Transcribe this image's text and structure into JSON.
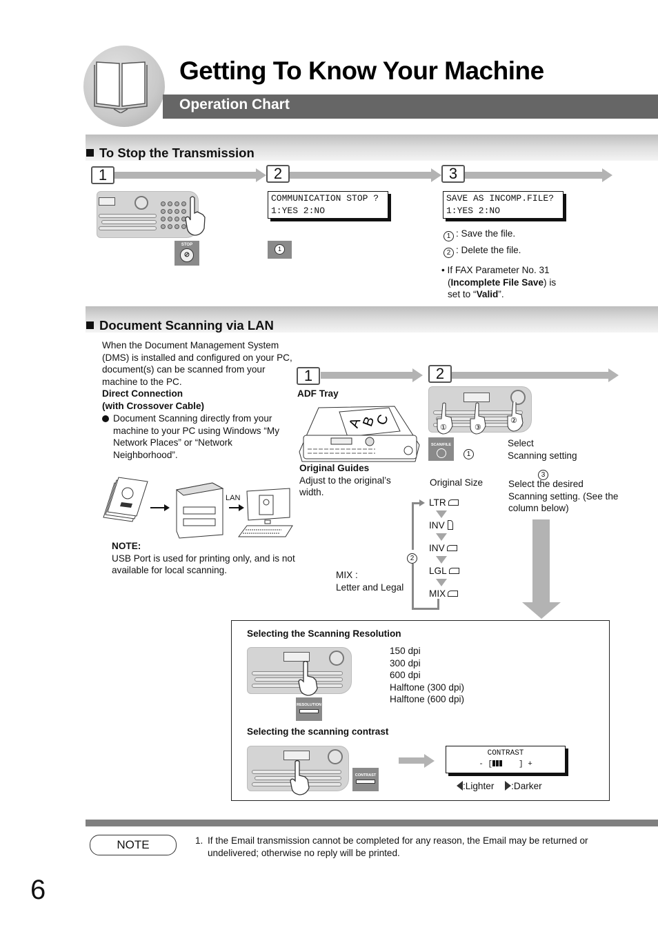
{
  "header": {
    "title": "Getting To Know Your Machine",
    "subtitle": "Operation Chart",
    "icon": "book-icon"
  },
  "stop_section": {
    "title": "To Stop the Transmission",
    "steps": [
      {
        "number": "1",
        "button_label": "STOP"
      },
      {
        "number": "2",
        "lcd_line1": "COMMUNICATION STOP ?",
        "lcd_line2": "1:YES 2:NO",
        "button_label": "1"
      },
      {
        "number": "3",
        "lcd_line1": "SAVE AS INCOMP.FILE?",
        "lcd_line2": "1:YES 2:NO",
        "options": [
          {
            "key": "1",
            "text": ": Save the file."
          },
          {
            "key": "2",
            "text": ": Delete the file."
          }
        ],
        "note_prefix": "• If FAX Parameter No. 31",
        "note_open": "(",
        "note_bold1": "Incomplete File Save",
        "note_mid": ") is",
        "note_set": "set to “",
        "note_bold2": "Valid",
        "note_end": "”."
      }
    ]
  },
  "scan_section": {
    "title": "Document Scanning via LAN",
    "intro": "When the Document Management System (DMS) is installed and configured on your PC, document(s) can be scanned from your machine to the PC.",
    "direct_connection_line1": "Direct Connection",
    "direct_connection_line2": "(with Crossover Cable)",
    "bullet": "Document Scanning directly from your machine to your PC using Windows “My Network Places” or “Network Neighborhood”.",
    "lan_label": "LAN",
    "note_title": "NOTE:",
    "note_text": "USB Port is used for printing only, and is not available for local scanning.",
    "step1": {
      "number": "1",
      "label": "ADF Tray",
      "doc_letters": [
        "A",
        "B",
        "C"
      ],
      "guides_title": "Original Guides",
      "guides_text": "Adjust to the original’s width."
    },
    "step2": {
      "number": "2",
      "scan_button_label": "SCAN/FILE",
      "callouts": [
        "1",
        "3",
        "2"
      ],
      "select_key": "1",
      "select_text1": "Select",
      "select_text2": "Scanning setting",
      "desired_key": "3",
      "desired_text": "Select the desired Scanning setting. (See the column below)",
      "original_size_label": "Original Size",
      "cycle_key": "2",
      "sizes": [
        {
          "label": "LTR",
          "orientation": "landscape"
        },
        {
          "label": "INV",
          "orientation": "portrait"
        },
        {
          "label": "INV",
          "orientation": "landscape"
        },
        {
          "label": "LGL",
          "orientation": "landscape"
        },
        {
          "label": "MIX",
          "orientation": "landscape"
        }
      ],
      "mix_label": "MIX :",
      "mix_desc": "Letter and Legal"
    },
    "resolution": {
      "title": "Selecting the Scanning Resolution",
      "button_label": "RESOLUTION",
      "options": [
        "150 dpi",
        "300 dpi",
        "600 dpi",
        "Halftone (300 dpi)",
        "Halftone (600 dpi)"
      ]
    },
    "contrast": {
      "title": "Selecting the scanning contrast",
      "button_label": "CONTRAST",
      "lcd_title": "CONTRAST",
      "lcd_minus": "- [",
      "lcd_plus": "] +",
      "level_fraction": 0.375,
      "lighter_label": ":Lighter",
      "darker_label": ":Darker"
    }
  },
  "footer": {
    "note_label": "NOTE",
    "note_number": "1.",
    "note_text": "If the Email transmission cannot be completed for any reason, the Email may be returned or undelivered; otherwise no reply will be printed.",
    "page_number": "6"
  }
}
